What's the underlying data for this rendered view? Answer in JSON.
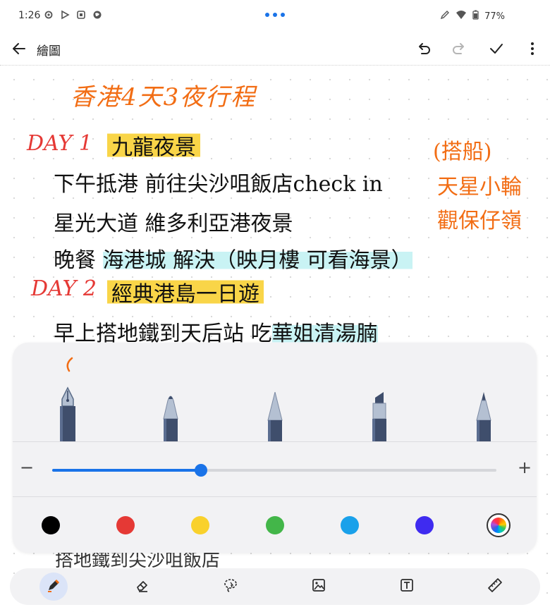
{
  "status_bar": {
    "time": "1:26",
    "battery": "77%"
  },
  "app_bar": {
    "title": "繪圖"
  },
  "note": {
    "title": "香港4天3夜行程",
    "day1_label": "DAY 1",
    "day1_title": "九龍夜景",
    "day1_line1": "下午抵港 前往尖沙咀飯店check in",
    "day1_line2": "星光大道 維多利亞港夜景",
    "day1_line3_a": "晚餐 ",
    "day1_line3_b": "海港城 解決（映月樓 可看海景）",
    "day2_label": "DAY 2",
    "day2_title": "經典港島一日遊",
    "day2_line1_a": "早上搭地鐵到天后站 吃",
    "day2_line1_b": "華姐清湯腩",
    "side_1": "(搭船)",
    "side_2": "天星小輪",
    "side_3": "觀保仔嶺",
    "partial_line": "搭地鐵到尖沙咀飯店"
  },
  "pen_panel": {
    "pens": [
      "fountain-pen",
      "ballpoint-pen",
      "brush-pen",
      "highlighter",
      "pencil"
    ],
    "selected_pen": "fountain-pen",
    "size_fraction": 0.335,
    "minus": "−",
    "plus": "+",
    "colors": [
      "#000000",
      "#e53935",
      "#f9d12c",
      "#43b649",
      "#1aa1ea",
      "#3f2bf0"
    ]
  },
  "toolbar": {
    "tools": [
      "pen-icon",
      "eraser-icon",
      "lasso-icon",
      "image-icon",
      "text-icon",
      "ruler-icon"
    ],
    "active": "pen-icon"
  }
}
